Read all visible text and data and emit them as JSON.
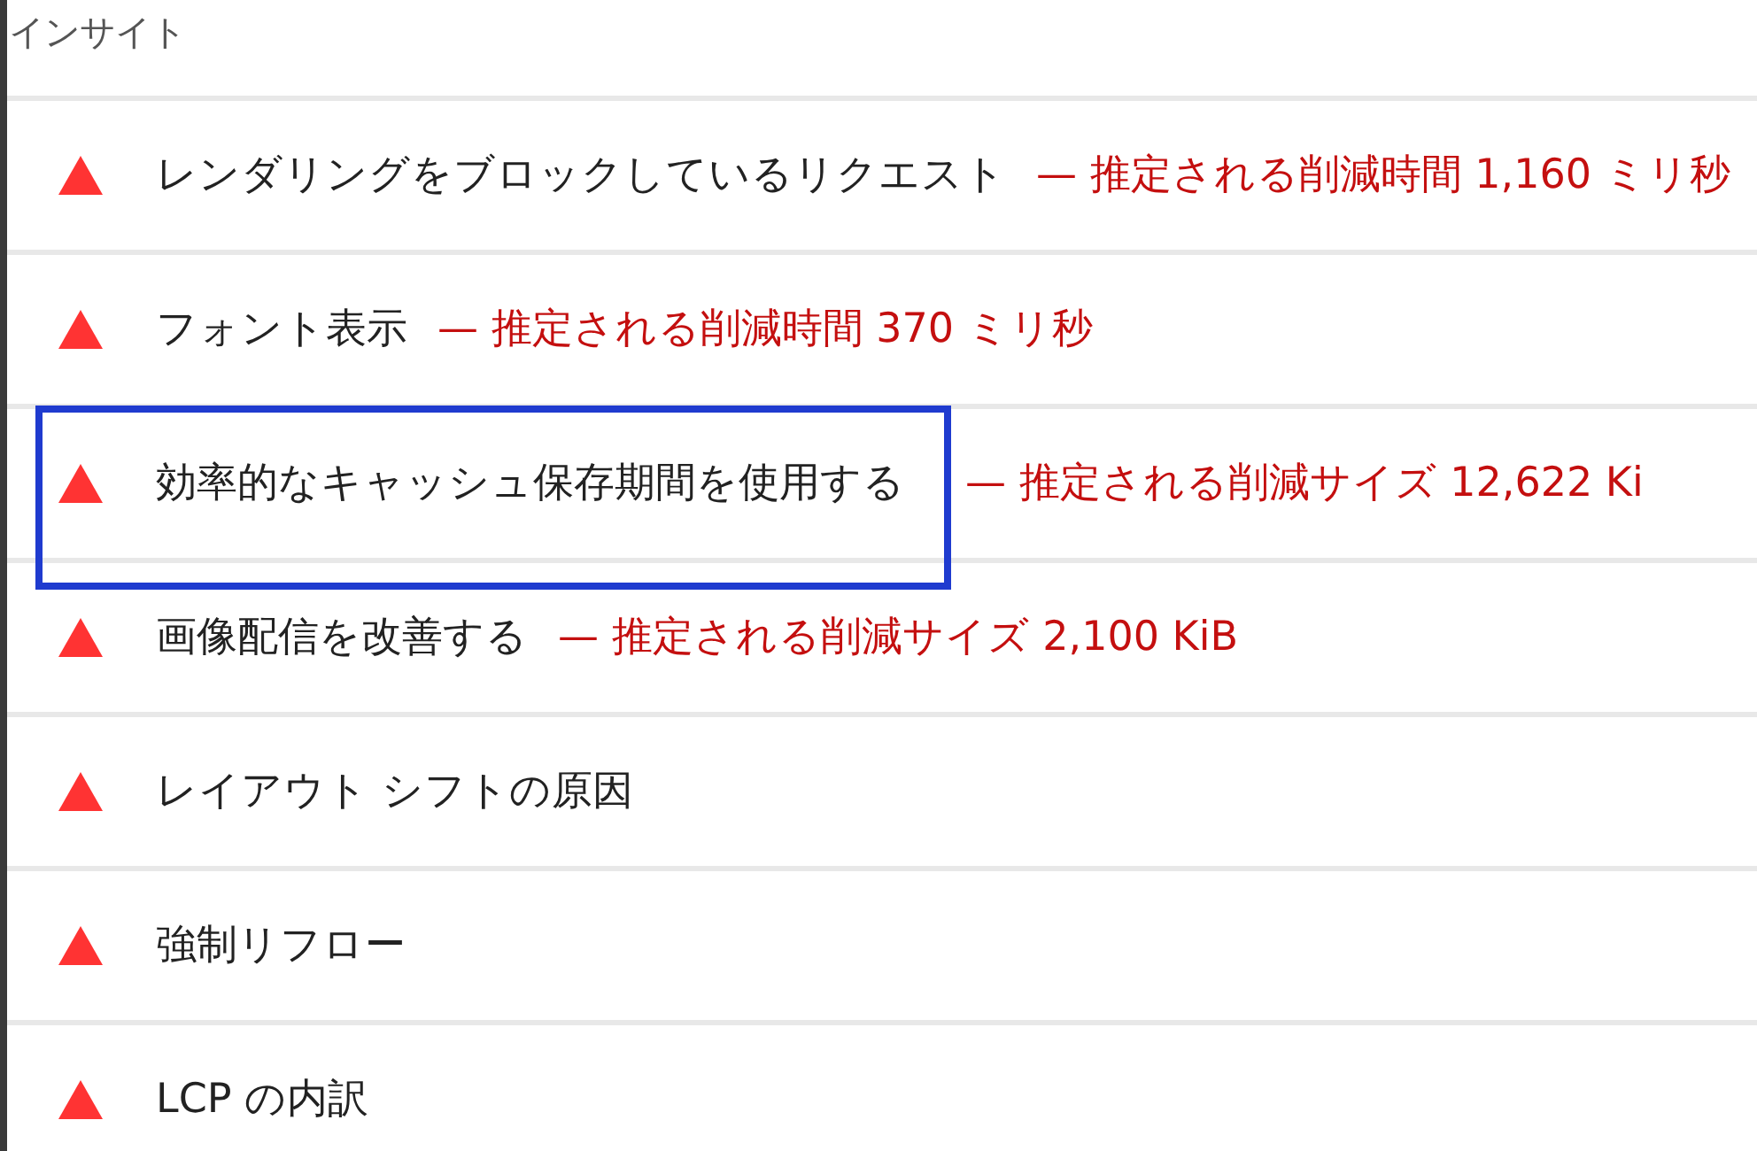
{
  "section": {
    "title": "インサイト"
  },
  "insights": [
    {
      "title": "レンダリングをブロックしているリクエスト",
      "savings": "— 推定される削減時間 1,160 ミリ秒",
      "highlighted": false
    },
    {
      "title": "フォント表示",
      "savings": "— 推定される削減時間 370 ミリ秒",
      "highlighted": false
    },
    {
      "title": "効率的なキャッシュ保存期間を使用する",
      "savings": "— 推定される削減サイズ 12,622 Ki",
      "highlighted": true
    },
    {
      "title": "画像配信を改善する",
      "savings": "— 推定される削減サイズ 2,100 KiB",
      "highlighted": false
    },
    {
      "title": "レイアウト シフトの原因",
      "highlighted": false
    },
    {
      "title": "強制リフロー",
      "highlighted": false
    },
    {
      "title": "LCP の内訳",
      "highlighted": false
    }
  ]
}
